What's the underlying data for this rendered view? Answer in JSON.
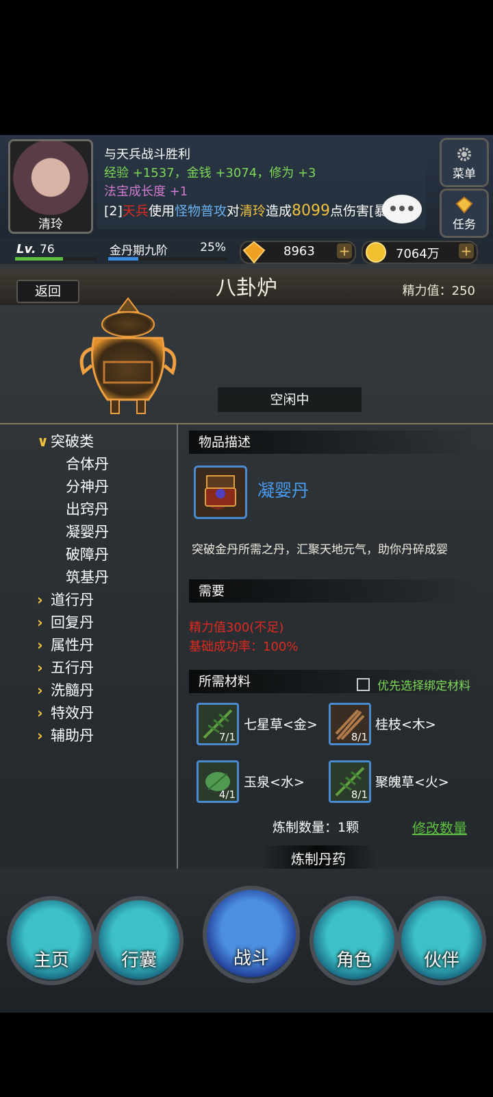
{
  "header": {
    "character_name": "清玲",
    "log_line1": "与天兵战斗胜利",
    "log_line2": "经验 +1537，金钱 +3074，修为 +3",
    "log_line3": "法宝成长度 +1",
    "log_line4_prefix": "[2]",
    "log_line4_attacker": "天兵",
    "log_line4_use": "使用",
    "log_line4_skill": "怪物普攻",
    "log_line4_to": "对",
    "log_line4_target": "清玲",
    "log_line4_cause": "造成",
    "log_line4_damage": "8099",
    "log_line4_suffix": "点伤害[暴击]",
    "menu_label": "菜单",
    "task_label": "任务"
  },
  "status": {
    "level_prefix": "Lv.",
    "level": "76",
    "realm": "金丹期九阶",
    "realm_progress": "25%",
    "gems": "8963",
    "gold": "7064万",
    "plus": "+"
  },
  "furnace": {
    "back_label": "返回",
    "title": "八卦炉",
    "energy": "精力值：250",
    "state": "空闲中"
  },
  "categories": [
    {
      "label": "突破类",
      "arrow": "∨",
      "expanded": true
    },
    {
      "label": "道行丹",
      "arrow": "›"
    },
    {
      "label": "回复丹",
      "arrow": "›"
    },
    {
      "label": "属性丹",
      "arrow": "›"
    },
    {
      "label": "五行丹",
      "arrow": "›"
    },
    {
      "label": "洗髓丹",
      "arrow": "›"
    },
    {
      "label": "特效丹",
      "arrow": "›"
    },
    {
      "label": "辅助丹",
      "arrow": "›"
    }
  ],
  "subitems": [
    "合体丹",
    "分神丹",
    "出窍丹",
    "凝婴丹",
    "破障丹",
    "筑基丹"
  ],
  "detail": {
    "desc_header": "物品描述",
    "item_name": "凝婴丹",
    "item_desc": "突破金丹所需之丹，汇聚天地元气，助你丹碎成婴",
    "req_header": "需要",
    "req_energy": "精力值300(不足)",
    "req_rate": "基础成功率：100%",
    "mat_header": "所需材料",
    "prefer_bound": "优先选择绑定材料",
    "materials": [
      {
        "name": "七星草<金>",
        "count": "7/1"
      },
      {
        "name": "桂枝<木>",
        "count": "8/1"
      },
      {
        "name": "玉泉<水>",
        "count": "4/1"
      },
      {
        "name": "聚魄草<火>",
        "count": "8/1"
      }
    ],
    "quantity": "炼制数量：1颗",
    "modify": "修改数量",
    "craft": "炼制丹药"
  },
  "nav": {
    "home": "主页",
    "bag": "行囊",
    "fight": "战斗",
    "role": "角色",
    "partner": "伙伴"
  },
  "colors": {
    "exp_green": "#7ed957",
    "accent_blue": "#4a9cf0",
    "warn_red": "#e02a20",
    "link_green": "#5ec040",
    "gold": "#f0c040"
  }
}
